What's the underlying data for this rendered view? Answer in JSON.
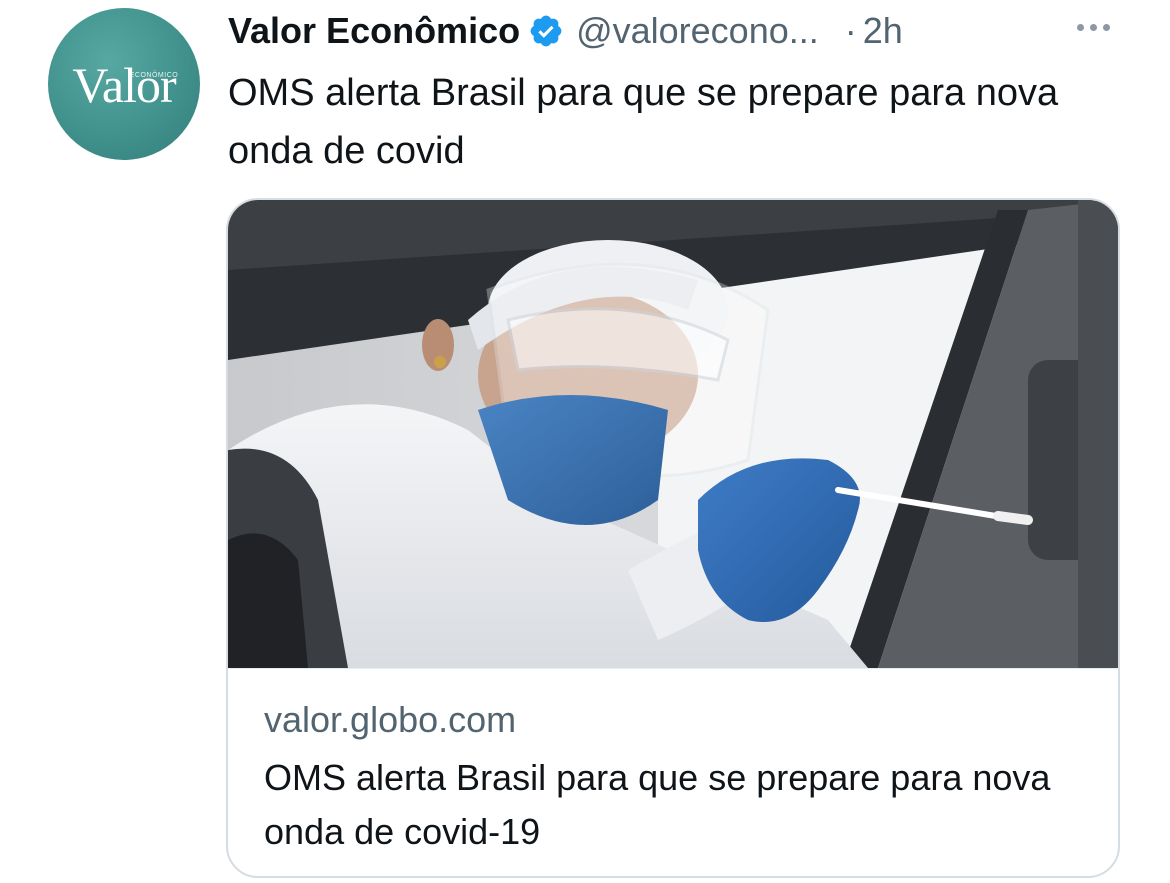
{
  "tweet": {
    "author": {
      "display_name": "Valor Econômico",
      "handle": "@valorecono...",
      "verified_icon": "verified-badge-icon",
      "avatar": {
        "logo_text": "Valor",
        "logo_subtext": "ECONÔMICO",
        "color": "#3f8f8b"
      }
    },
    "separator": "·",
    "time": "2h",
    "more_icon": "more-options-icon",
    "text": "OMS alerta Brasil para que se prepare para nova onda de covid",
    "card": {
      "domain": "valor.globo.com",
      "title": "OMS alerta Brasil para que se prepare para nova onda de covid-19"
    }
  },
  "colors": {
    "text_primary": "#0f1419",
    "text_secondary": "#536471",
    "verified_blue": "#1d9bf0",
    "card_border": "#d5dde3",
    "avatar_teal": "#3f8f8b"
  }
}
